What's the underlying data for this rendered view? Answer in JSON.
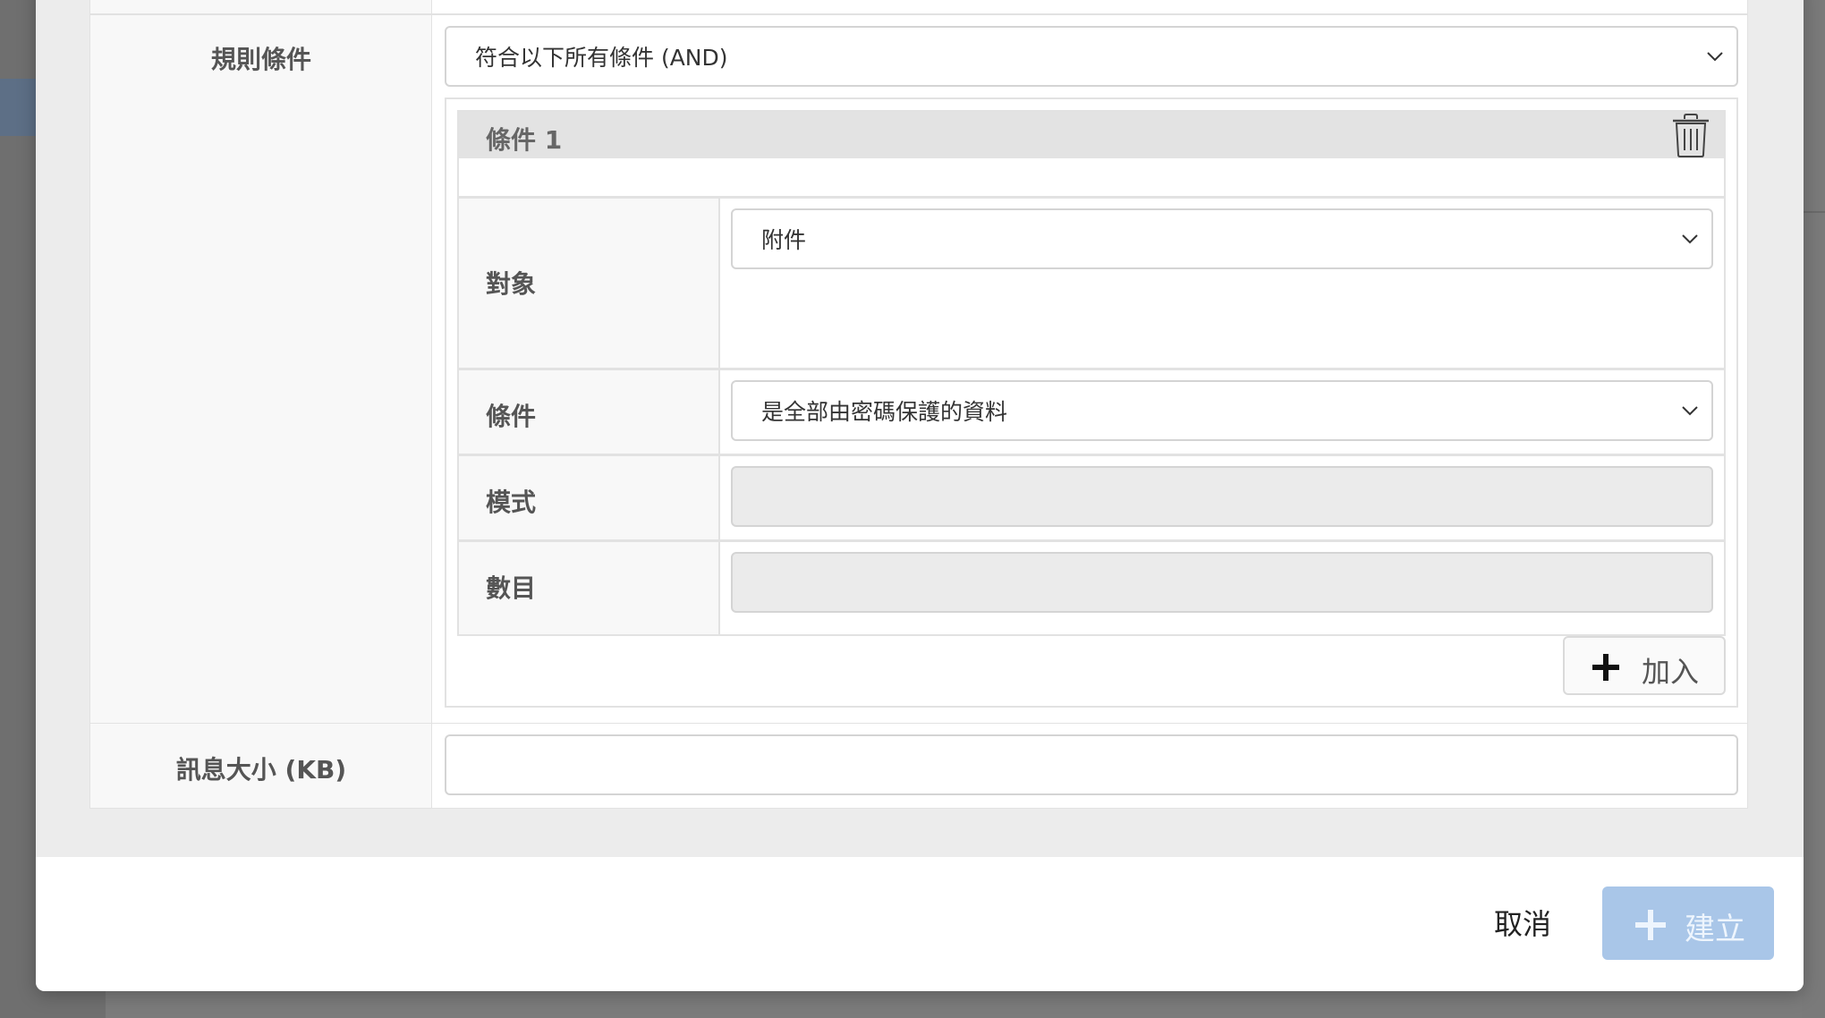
{
  "form": {
    "rule_conditions_label": "規則條件",
    "match_mode_value": "符合以下所有條件 (AND)",
    "condition": {
      "title": "條件 1",
      "target_label": "對象",
      "target_value": "附件",
      "criteria_label": "條件",
      "criteria_value": "是全部由密碼保護的資料",
      "pattern_label": "模式",
      "pattern_value": "",
      "count_label": "數目",
      "count_value": ""
    },
    "add_label": "加入",
    "message_size_label": "訊息大小 (KB)",
    "message_size_value": ""
  },
  "footer": {
    "cancel_label": "取消",
    "create_label": "建立"
  },
  "icons": {
    "trash": "trash-icon",
    "chevron": "chevron-down-icon",
    "plus": "plus-icon"
  },
  "colors": {
    "primary_disabled": "#a9c6e8",
    "modal_bg": "#ececec"
  }
}
